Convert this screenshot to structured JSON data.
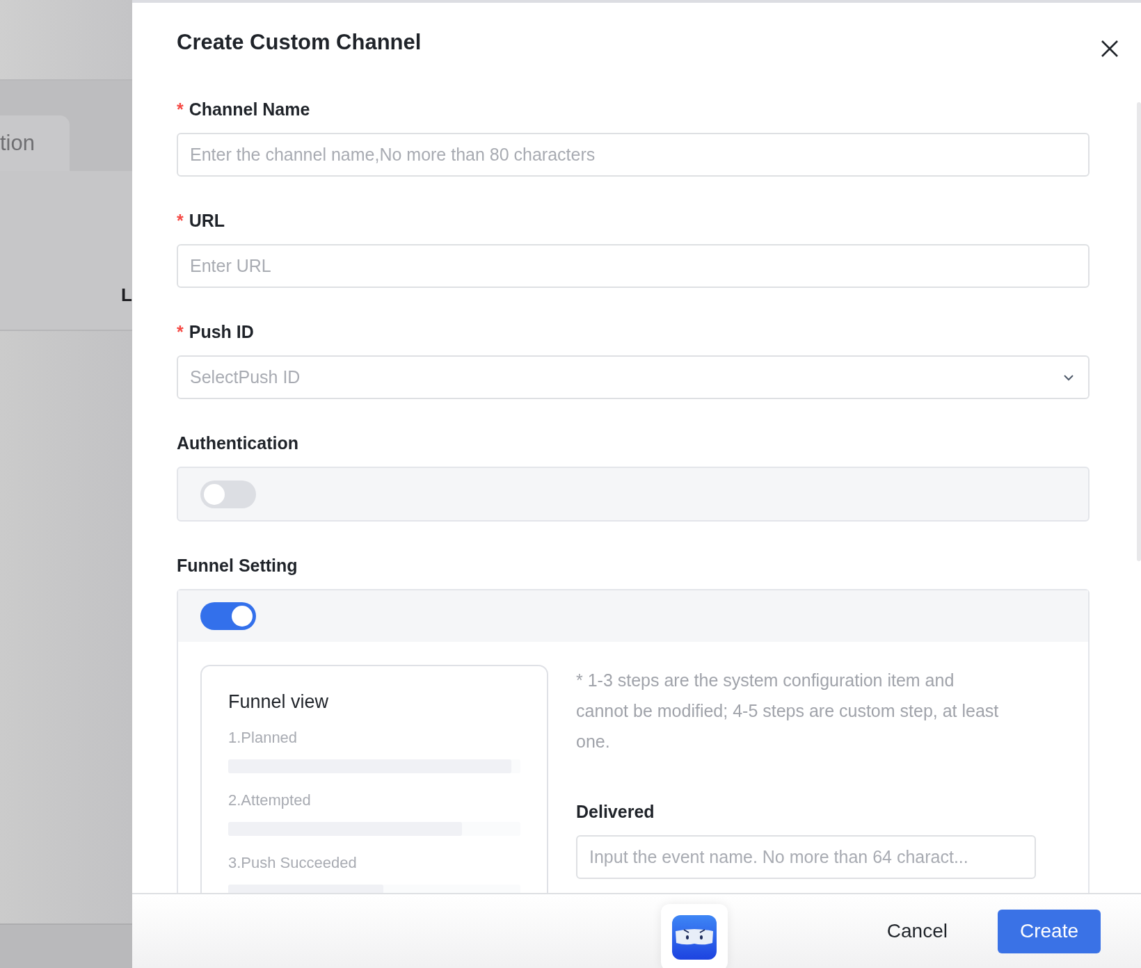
{
  "backdrop": {
    "tab_label": "tion",
    "row_text": "L"
  },
  "drawer": {
    "title": "Create Custom Channel",
    "fields": [
      {
        "kind": "input",
        "label": "Channel Name",
        "required": true,
        "placeholder": "Enter the channel name,No more than 80 characters"
      },
      {
        "kind": "input",
        "label": "URL",
        "required": true,
        "placeholder": "Enter URL"
      },
      {
        "kind": "select",
        "label": "Push ID",
        "required": true,
        "placeholder": "SelectPush ID"
      }
    ],
    "required_mark": "*",
    "authentication": {
      "label": "Authentication",
      "on": false
    },
    "funnel": {
      "label": "Funnel Setting",
      "on": true,
      "view": {
        "title": "Funnel view",
        "steps": [
          {
            "label": "1.Planned",
            "level": 0.97
          },
          {
            "label": "2.Attempted",
            "level": 0.8
          },
          {
            "label": "3.Push Succeeded",
            "level": 0.53
          }
        ]
      },
      "note": "* 1-3 steps are the system configuration item and cannot be modified; 4-5 steps are custom step, at least one.",
      "event": {
        "label": "Delivered",
        "placeholder": "Input the event name. No more than 64 charact..."
      }
    },
    "buttons": [
      {
        "kind": "secondary",
        "label": "Cancel"
      },
      {
        "kind": "primary",
        "label": "Create"
      }
    ]
  }
}
